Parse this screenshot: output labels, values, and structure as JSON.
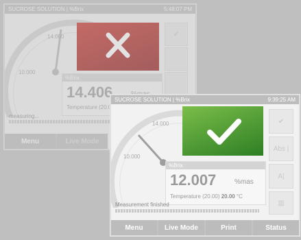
{
  "back_screen": {
    "title": "SUCROSE SOLUTION | %Brix",
    "time": "5:48:07 PM",
    "gauge": {
      "tick_high": "14.000",
      "tick_low": "10.000"
    },
    "readout": {
      "header": "%Brix",
      "value": "14.406",
      "unit": "%mas",
      "temp_text": "Temperature (20.00"
    },
    "message": "measuring...",
    "status": "fail",
    "status_color": "#c7261f",
    "menu": [
      "Menu",
      "Live Mode"
    ]
  },
  "front_screen": {
    "title": "SUCROSE SOLUTION | %Brix",
    "time": "9:39:25 AM",
    "gauge": {
      "tick_high": "14.000",
      "tick_low": "10.000"
    },
    "readout": {
      "header": "%Brix",
      "value": "12.007",
      "unit": "%mas",
      "temp_label": "Temperature (20.00)",
      "temp_value": "20.00",
      "temp_unit": "°C"
    },
    "message": "Measurement finished",
    "status": "pass",
    "status_color": "#4e9e36",
    "side_buttons": [
      "Abs |",
      "A|"
    ],
    "menu": [
      "Menu",
      "Live Mode",
      "Print",
      "Status"
    ]
  }
}
